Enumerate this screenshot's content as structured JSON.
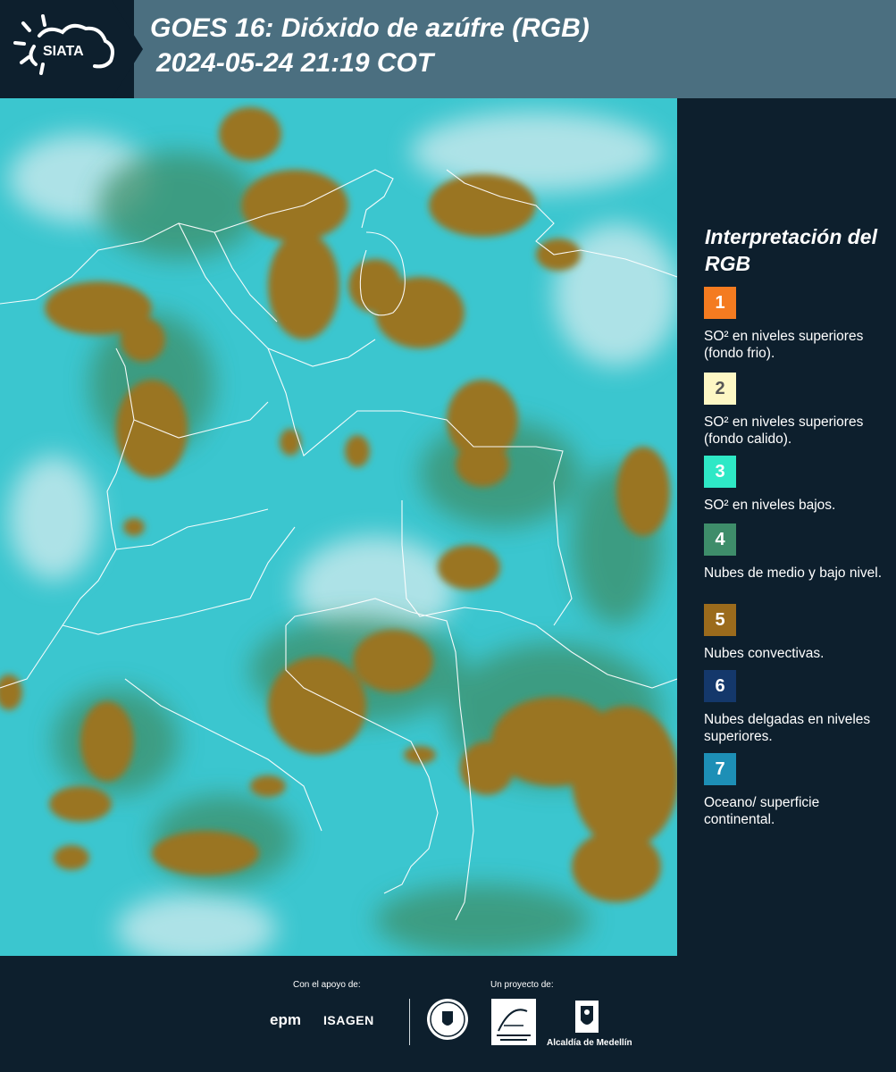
{
  "header": {
    "title_line1": "GOES 16: Dióxido de azúfre (RGB)",
    "title_line2": "2024-05-24 21:19 COT",
    "logo_text": "SIATA"
  },
  "map": {
    "colors": {
      "ocean_surface": "#35c5cc",
      "convective_clouds": "#9a7424",
      "mid_low_clouds": "#3e8f69",
      "boundaries": "#ffffff"
    }
  },
  "legend": {
    "title": "Interpretación del RGB",
    "items": [
      {
        "number": "1",
        "label": "SO² en niveles superiores (fondo frio).",
        "color": "#f47b20",
        "text_color": "#ffffff"
      },
      {
        "number": "2",
        "label": "SO² en niveles superiores (fondo calido).",
        "color": "#fdf7c4",
        "text_color": "#555555"
      },
      {
        "number": "3",
        "label": "SO² en niveles bajos.",
        "color": "#2ee8c6",
        "text_color": "#ffffff"
      },
      {
        "number": "4",
        "label": "Nubes de medio y bajo nivel.",
        "color": "#3e8d6a",
        "text_color": "#ffffff"
      },
      {
        "number": "5",
        "label": "Nubes convectivas.",
        "color": "#9b6b1c",
        "text_color": "#ffffff"
      },
      {
        "number": "6",
        "label": "Nubes delgadas en niveles superiores.",
        "color": "#14386b",
        "text_color": "#ffffff"
      },
      {
        "number": "7",
        "label": "Oceano/ superficie continental.",
        "color": "#1d8fb6",
        "text_color": "#ffffff"
      }
    ]
  },
  "footer": {
    "support_label": "Con el apoyo de:",
    "project_label": "Un proyecto de:",
    "sponsors": [
      "epm",
      "ISAGEN"
    ],
    "alcaldia": "Alcaldía de Medellín"
  }
}
